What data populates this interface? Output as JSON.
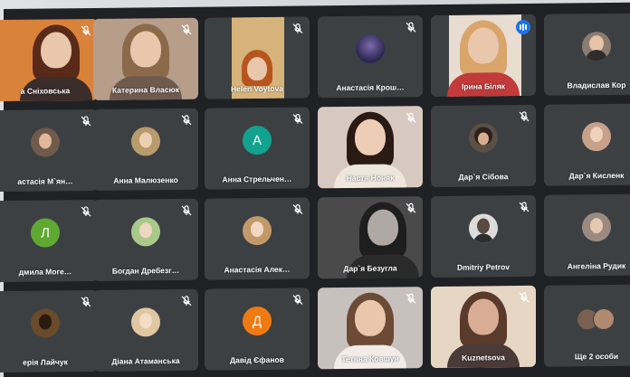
{
  "participants": [
    {
      "name": "а Сніховська",
      "avatar_letter": "",
      "avatar_color": "#d9823a",
      "kind": "video",
      "muted": true
    },
    {
      "name": "Катерина Власюк",
      "avatar_letter": "",
      "avatar_color": "#b79e8a",
      "kind": "video",
      "muted": true
    },
    {
      "name": "Helen Voytova",
      "avatar_letter": "",
      "avatar_color": "#d6b37a",
      "kind": "video",
      "muted": true
    },
    {
      "name": "Анастасія Крош…",
      "avatar_letter": "",
      "avatar_color": "#2a2550",
      "kind": "photo",
      "muted": true
    },
    {
      "name": "Ірина Біляк",
      "avatar_letter": "",
      "avatar_color": "#e8b19a",
      "kind": "video",
      "muted": false
    },
    {
      "name": "Владислав Кор",
      "avatar_letter": "",
      "avatar_color": "#8a7c70",
      "kind": "photo",
      "muted": true
    },
    {
      "name": "астасія М`ян…",
      "avatar_letter": "",
      "avatar_color": "#6f5a4c",
      "kind": "photo",
      "muted": true
    },
    {
      "name": "Анна Малюзенко",
      "avatar_letter": "",
      "avatar_color": "#b89b6c",
      "kind": "photo",
      "muted": true
    },
    {
      "name": "Анна Стрельчен…",
      "avatar_letter": "A",
      "avatar_color": "#12a28f",
      "kind": "letter",
      "muted": true
    },
    {
      "name": "Настя Ноняк",
      "avatar_letter": "",
      "avatar_color": "#d7b9a6",
      "kind": "video",
      "muted": true
    },
    {
      "name": "Дар`я Сібова",
      "avatar_letter": "",
      "avatar_color": "#5b5046",
      "kind": "photo",
      "muted": true
    },
    {
      "name": "Дар`я Кисленк",
      "avatar_letter": "",
      "avatar_color": "#c7a18a",
      "kind": "photo",
      "muted": true
    },
    {
      "name": "дмила Моге…",
      "avatar_letter": "Л",
      "avatar_color": "#5fa832",
      "kind": "letter",
      "muted": true
    },
    {
      "name": "Богдан Дребезг…",
      "avatar_letter": "",
      "avatar_color": "#a9c98a",
      "kind": "photo",
      "muted": true
    },
    {
      "name": "Анастасія Алек…",
      "avatar_letter": "",
      "avatar_color": "#c29a6a",
      "kind": "photo",
      "muted": true
    },
    {
      "name": "Дар`я Безугла",
      "avatar_letter": "",
      "avatar_color": "#3a3a3a",
      "kind": "video",
      "muted": true
    },
    {
      "name": "Dmitriy Petrov",
      "avatar_letter": "",
      "avatar_color": "#dcdcdc",
      "kind": "photo",
      "muted": true
    },
    {
      "name": "Ангеліна Рудик",
      "avatar_letter": "",
      "avatar_color": "#9a8a80",
      "kind": "photo",
      "muted": true
    },
    {
      "name": "ерія Лайчук",
      "avatar_letter": "",
      "avatar_color": "#6a4a2a",
      "kind": "photo",
      "muted": true
    },
    {
      "name": "Діана Атаманська",
      "avatar_letter": "",
      "avatar_color": "#e0c7a2",
      "kind": "photo",
      "muted": true
    },
    {
      "name": "Давід Єфанов",
      "avatar_letter": "Д",
      "avatar_color": "#f07a12",
      "kind": "letter",
      "muted": true
    },
    {
      "name": "Тетяна Ковшун",
      "avatar_letter": "",
      "avatar_color": "#c8c0bd",
      "kind": "video",
      "muted": true
    },
    {
      "name": "Kuznetsova",
      "avatar_letter": "",
      "avatar_color": "#c49a86",
      "kind": "video",
      "muted": true
    },
    {
      "name": "Ще 2 особи",
      "avatar_letter": "",
      "avatar_color": "#3c4043",
      "kind": "more",
      "muted": false
    }
  ],
  "colors": {
    "meet_background": "#202124",
    "tile": "#3c4043",
    "speaking_indicator": "#1a73e8"
  }
}
